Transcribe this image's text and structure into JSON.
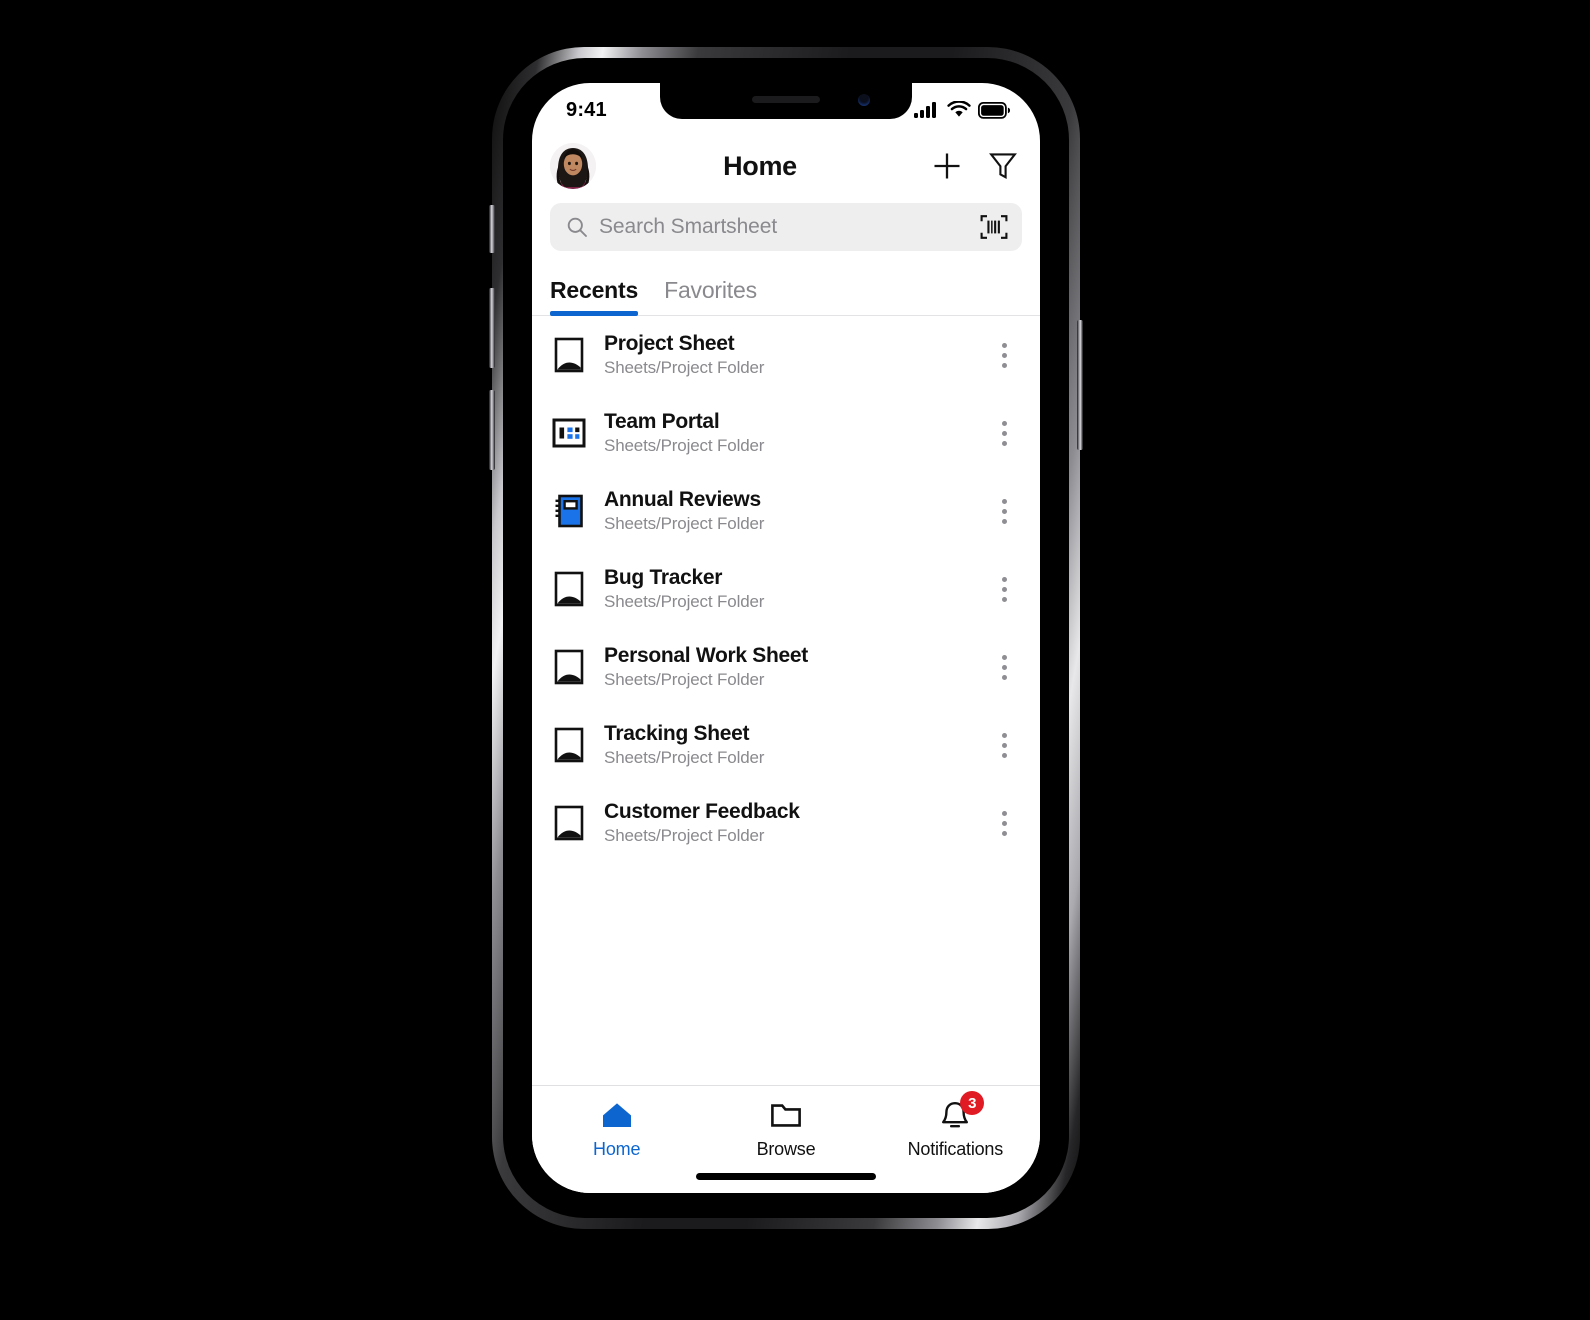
{
  "status_bar": {
    "time": "9:41",
    "signal_icon": "cellular-signal-icon",
    "wifi_icon": "wifi-icon",
    "battery_icon": "battery-icon"
  },
  "header": {
    "title": "Home",
    "avatar_name": "user-avatar",
    "add_label": "+",
    "add_icon": "plus-icon",
    "filter_icon": "filter-funnel-icon"
  },
  "search": {
    "placeholder": "Search Smartsheet",
    "search_icon": "search-icon",
    "scan_icon": "barcode-scanner-icon"
  },
  "tabs": [
    {
      "label": "Recents",
      "active": true
    },
    {
      "label": "Favorites",
      "active": false
    }
  ],
  "list": [
    {
      "title": "Project Sheet",
      "subtitle": "Sheets/Project Folder",
      "icon": "sheet-icon"
    },
    {
      "title": "Team Portal",
      "subtitle": "Sheets/Project Folder",
      "icon": "dashboard-icon"
    },
    {
      "title": "Annual Reviews",
      "subtitle": "Sheets/Project Folder",
      "icon": "report-icon"
    },
    {
      "title": "Bug Tracker",
      "subtitle": "Sheets/Project Folder",
      "icon": "sheet-icon"
    },
    {
      "title": "Personal Work Sheet",
      "subtitle": "Sheets/Project Folder",
      "icon": "sheet-icon"
    },
    {
      "title": "Tracking Sheet",
      "subtitle": "Sheets/Project Folder",
      "icon": "sheet-icon"
    },
    {
      "title": "Customer Feedback",
      "subtitle": "Sheets/Project Folder",
      "icon": "sheet-icon"
    }
  ],
  "tabbar": [
    {
      "label": "Home",
      "icon": "home-icon",
      "active": true,
      "badge": null
    },
    {
      "label": "Browse",
      "icon": "folder-icon",
      "active": false,
      "badge": null
    },
    {
      "label": "Notifications",
      "icon": "bell-icon",
      "active": false,
      "badge": "3"
    }
  ],
  "colors": {
    "accent": "#0d66d0",
    "badge": "#e01b24",
    "subtitle": "#8a8a8e",
    "search_bg": "#eeeeef"
  }
}
